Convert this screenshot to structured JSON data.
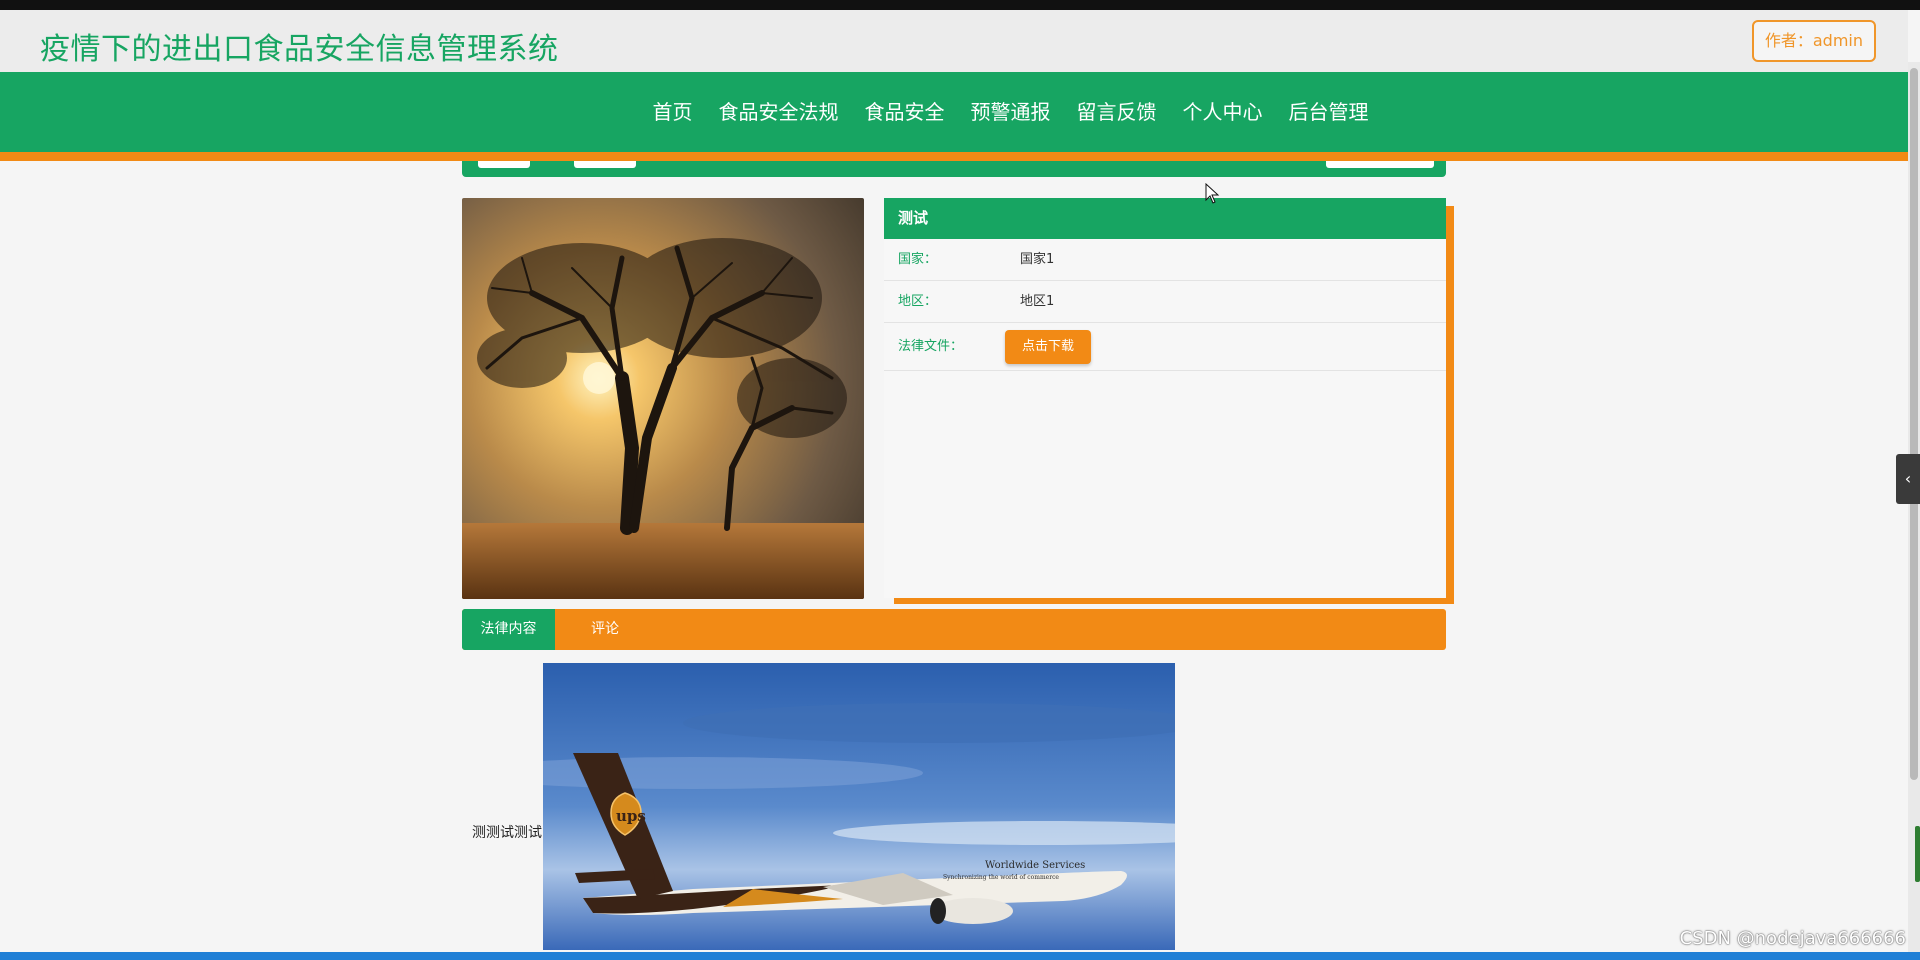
{
  "header": {
    "title": "疫情下的进出口食品安全信息管理系统",
    "author_label": "作者：admin"
  },
  "nav": {
    "items": [
      {
        "label": "首页"
      },
      {
        "label": "食品安全法规"
      },
      {
        "label": "食品安全"
      },
      {
        "label": "预警通报"
      },
      {
        "label": "留言反馈"
      },
      {
        "label": "个人中心"
      },
      {
        "label": "后台管理"
      }
    ]
  },
  "detail": {
    "title": "测试",
    "country_label": "国家：",
    "country_value": "国家1",
    "region_label": "地区：",
    "region_value": "地区1",
    "file_label": "法律文件：",
    "download_label": "点击下载"
  },
  "tabs": [
    {
      "label": "法律内容"
    },
    {
      "label": "评论"
    }
  ],
  "content": {
    "text": "测测试测试"
  },
  "images": {
    "plane_brand": "ups",
    "plane_text_1": "Worldwide Services",
    "plane_text_2": "Synchronizing the world of commerce"
  },
  "watermark": "CSDN @nodejava666666",
  "colors": {
    "green": "#17a562",
    "orange": "#f28a15"
  },
  "icons": {
    "side_toggle": "chevron-left-icon"
  }
}
